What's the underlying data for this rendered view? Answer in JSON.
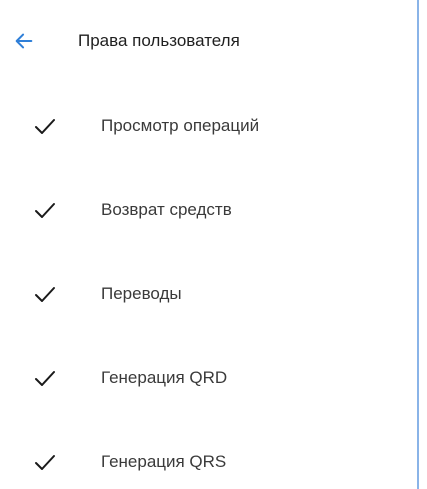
{
  "header": {
    "title": "Права пользователя",
    "back_icon": "arrow-left-icon",
    "accent_color": "#2f7fd8"
  },
  "permissions": [
    {
      "label": "Просмотр операций",
      "checked": true
    },
    {
      "label": "Возврат средств",
      "checked": true
    },
    {
      "label": "Переводы",
      "checked": true
    },
    {
      "label": "Генерация QRD",
      "checked": true
    },
    {
      "label": "Генерация QRS",
      "checked": true
    }
  ]
}
